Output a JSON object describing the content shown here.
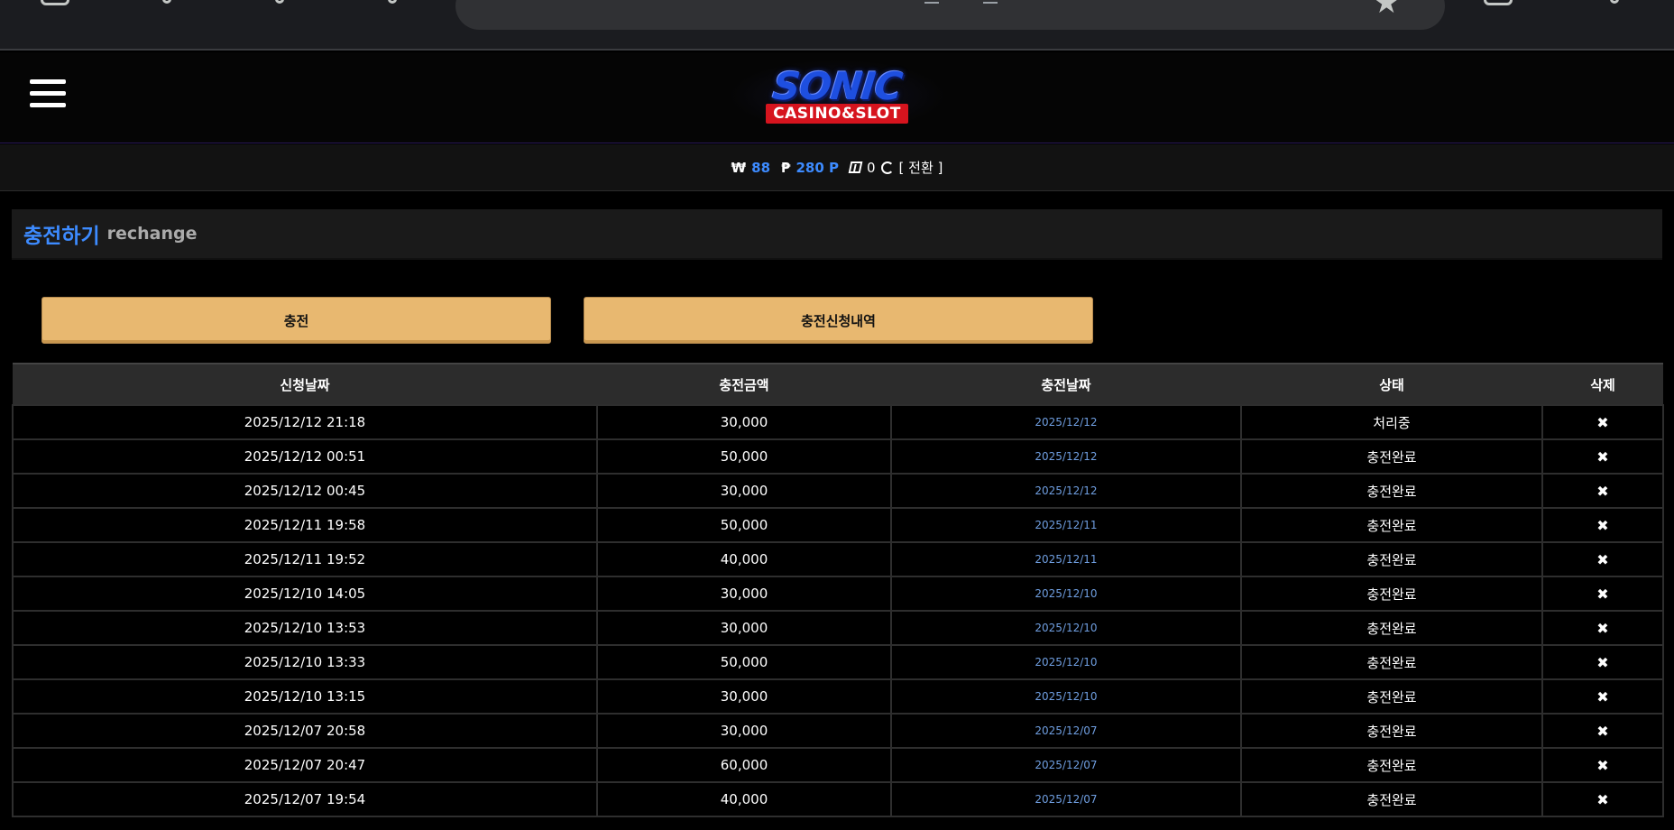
{
  "logo": {
    "main": "SONIC",
    "sub": "CASINO&SLOT"
  },
  "balance": {
    "won_symbol": "₩",
    "won_value": "88",
    "point_symbol": "₱",
    "point_value": "280 P",
    "comp_value": "0",
    "switch_label": "[ 전환 ]"
  },
  "section": {
    "title_ko": "충전하기",
    "title_en": "rechange"
  },
  "tabs": {
    "recharge": "충전",
    "history": "충전신청내역"
  },
  "table": {
    "headers": [
      "신청날짜",
      "충전금액",
      "충전날짜",
      "상태",
      "삭제"
    ],
    "delete_glyph": "✖",
    "rows": [
      {
        "request": "2025/12/12 21:18",
        "amount": "30,000",
        "date": "2025/12/12",
        "status": "처리중"
      },
      {
        "request": "2025/12/12 00:51",
        "amount": "50,000",
        "date": "2025/12/12",
        "status": "충전완료"
      },
      {
        "request": "2025/12/12 00:45",
        "amount": "30,000",
        "date": "2025/12/12",
        "status": "충전완료"
      },
      {
        "request": "2025/12/11 19:58",
        "amount": "50,000",
        "date": "2025/12/11",
        "status": "충전완료"
      },
      {
        "request": "2025/12/11 19:52",
        "amount": "40,000",
        "date": "2025/12/11",
        "status": "충전완료"
      },
      {
        "request": "2025/12/10 14:05",
        "amount": "30,000",
        "date": "2025/12/10",
        "status": "충전완료"
      },
      {
        "request": "2025/12/10 13:53",
        "amount": "30,000",
        "date": "2025/12/10",
        "status": "충전완료"
      },
      {
        "request": "2025/12/10 13:33",
        "amount": "50,000",
        "date": "2025/12/10",
        "status": "충전완료"
      },
      {
        "request": "2025/12/10 13:15",
        "amount": "30,000",
        "date": "2025/12/10",
        "status": "충전완료"
      },
      {
        "request": "2025/12/07 20:58",
        "amount": "30,000",
        "date": "2025/12/07",
        "status": "충전완료"
      },
      {
        "request": "2025/12/07 20:47",
        "amount": "60,000",
        "date": "2025/12/07",
        "status": "충전완료"
      },
      {
        "request": "2025/12/07 19:54",
        "amount": "40,000",
        "date": "2025/12/07",
        "status": "충전완료"
      }
    ]
  }
}
